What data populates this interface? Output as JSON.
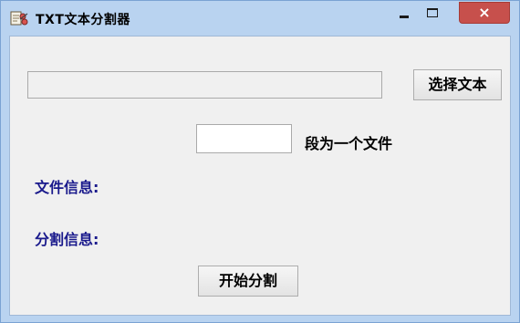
{
  "window": {
    "title": "TXT文本分割器",
    "app_icon": "scissors-doc-icon",
    "minimize_icon": "minimize-icon",
    "maximize_icon": "maximize-icon",
    "close_glyph": "×",
    "close_color": "#c7504c"
  },
  "main": {
    "file_path_value": "",
    "select_text_label": "选择文本",
    "segment_count_value": "",
    "segment_suffix": "段为一个文件",
    "file_info_label": "文件信息:",
    "split_info_label": "分割信息:",
    "start_split_label": "开始分割",
    "label_color": "#1a1a8c"
  }
}
